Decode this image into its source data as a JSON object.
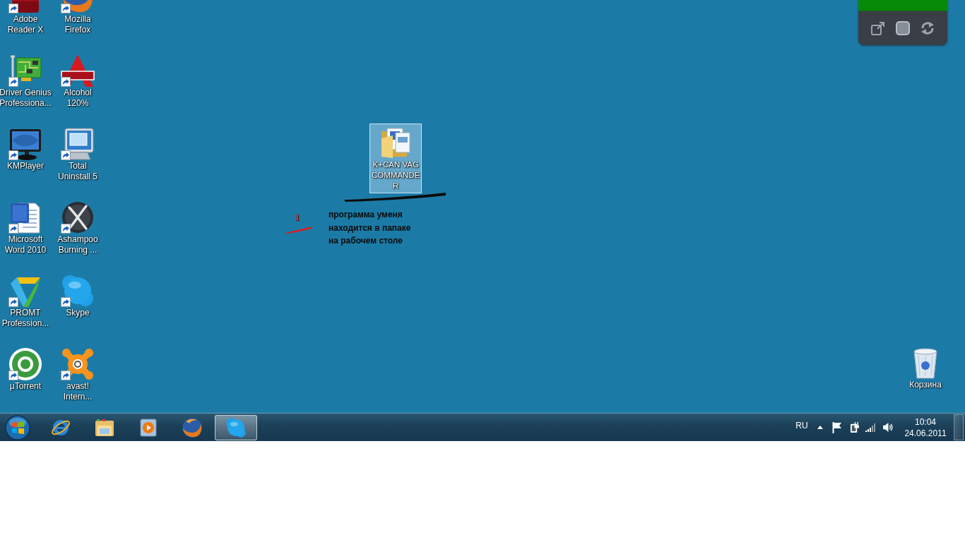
{
  "desktop": {
    "icons": [
      {
        "label": "Adobe\nReader X",
        "shortcut": true,
        "selected": false
      },
      {
        "label": "Mozilla\nFirefox",
        "shortcut": true,
        "selected": false
      },
      {
        "label": "Driver Genius\nProfessiona...",
        "shortcut": true,
        "selected": false
      },
      {
        "label": "Alcohol\n120%",
        "shortcut": true,
        "selected": false
      },
      {
        "label": "KMPlayer",
        "shortcut": true,
        "selected": false
      },
      {
        "label": "Total\nUninstall 5",
        "shortcut": true,
        "selected": false
      },
      {
        "label": "Microsoft\nWord 2010",
        "shortcut": true,
        "selected": false
      },
      {
        "label": "Ashampoo\nBurning ...",
        "shortcut": true,
        "selected": false
      },
      {
        "label": "PROMT\nProfession...",
        "shortcut": true,
        "selected": false
      },
      {
        "label": "Skype",
        "shortcut": true,
        "selected": false
      },
      {
        "label": "µTorrent",
        "shortcut": true,
        "selected": false
      },
      {
        "label": "avast!\nIntern...",
        "shortcut": true,
        "selected": false
      }
    ],
    "folder": {
      "label": "K+CAN VAG\nCOMMANDE\nR",
      "selected": true
    },
    "annotation": {
      "marker": "1",
      "note": "программа уменя\nнаходится в папаке\nна рабочем столе"
    },
    "recycle_bin": {
      "label": "Корзина",
      "selected": false
    }
  },
  "taskbar": {
    "buttons": [
      {
        "active": false
      },
      {
        "active": false
      },
      {
        "active": false
      },
      {
        "active": false
      },
      {
        "active": true
      }
    ],
    "language": "RU",
    "clock": {
      "time": "10:04",
      "date": "24.06.2011"
    }
  }
}
